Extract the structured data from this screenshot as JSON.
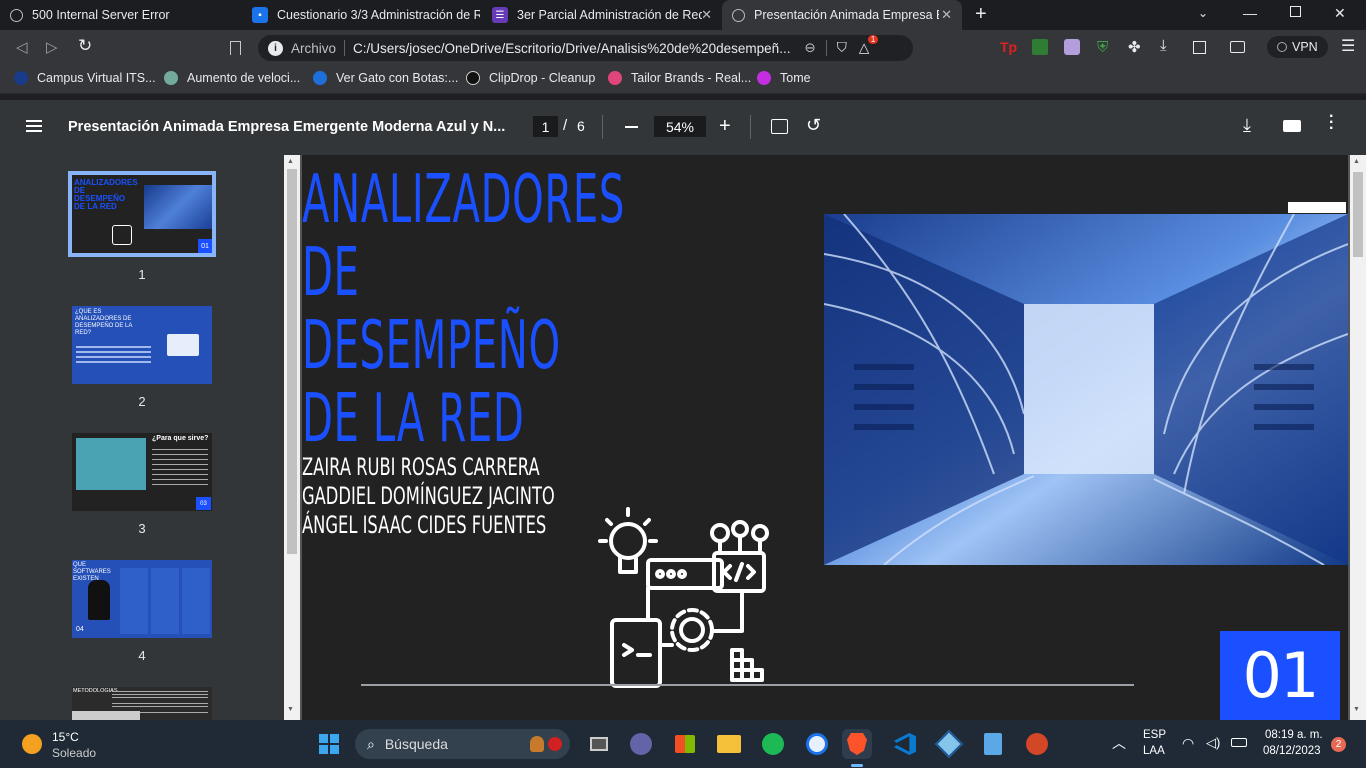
{
  "tabs": [
    {
      "title": "500 Internal Server Error",
      "icon": "globe-icon"
    },
    {
      "title": "Cuestionario 3/3 Administración de Re",
      "icon": "classroom-icon"
    },
    {
      "title": "3er Parcial Administración de Red",
      "icon": "forms-icon"
    },
    {
      "title": "Presentación Animada Empresa E",
      "icon": "globe-icon"
    }
  ],
  "address": {
    "secure_label": "Archivo",
    "url": "C:/Users/josec/OneDrive/Escritorio/Drive/Analisis%20de%20desempeñ...",
    "brave_badge": "1",
    "vpn_label": "VPN",
    "ext_label": "Tp"
  },
  "bookmarks": [
    {
      "label": "Campus Virtual ITS...",
      "color": "#1a3a8a"
    },
    {
      "label": "Aumento de veloci...",
      "color": "#74aa9c"
    },
    {
      "label": "Ver Gato con Botas:...",
      "color": "#1e6fd9"
    },
    {
      "label": "ClipDrop - Cleanup",
      "color": "#111111"
    },
    {
      "label": "Tailor Brands - Real...",
      "color": "#e0457b"
    },
    {
      "label": "Tome",
      "color": "#c22ee0"
    }
  ],
  "pdf": {
    "doc_title": "Presentación Animada Empresa Emergente Moderna Azul y N...",
    "page_current": "1",
    "page_sep": "/",
    "page_total": "6",
    "zoom": "54%"
  },
  "thumbnails": [
    {
      "num": "1",
      "badge": "01"
    },
    {
      "num": "2",
      "badge": ""
    },
    {
      "num": "3",
      "badge": "03"
    },
    {
      "num": "4",
      "badge": "04"
    }
  ],
  "thumb_text": {
    "t1_title": "ANALIZADORES DE DESEMPEÑO DE LA RED",
    "t2_title": "¿QUE ES ANALIZADORES DE DESEMPEÑO DE LA RED?",
    "t3_title": "¿Para que sirve?",
    "t4_title": "QUE SOFTWARES EXISTEN",
    "t5_title": "METODOLOGIAS"
  },
  "slide": {
    "title_line1": "ANALIZADORES",
    "title_line2": "DE DESEMPEÑO",
    "title_line3": "DE LA RED",
    "author1": "ZAIRA RUBI ROSAS CARRERA",
    "author2": "GADDIEL DOMÍNGUEZ JACINTO",
    "author3": "ÁNGEL ISAAC CIDES FUENTES",
    "slide_number": "01",
    "accent_color": "#1a50ff"
  },
  "taskbar": {
    "temp": "15°C",
    "weather": "Soleado",
    "search_placeholder": "Búsqueda",
    "lang1": "ESP",
    "lang2": "LAA",
    "time": "08:19 a. m.",
    "date": "08/12/2023",
    "notif_count": "2"
  }
}
